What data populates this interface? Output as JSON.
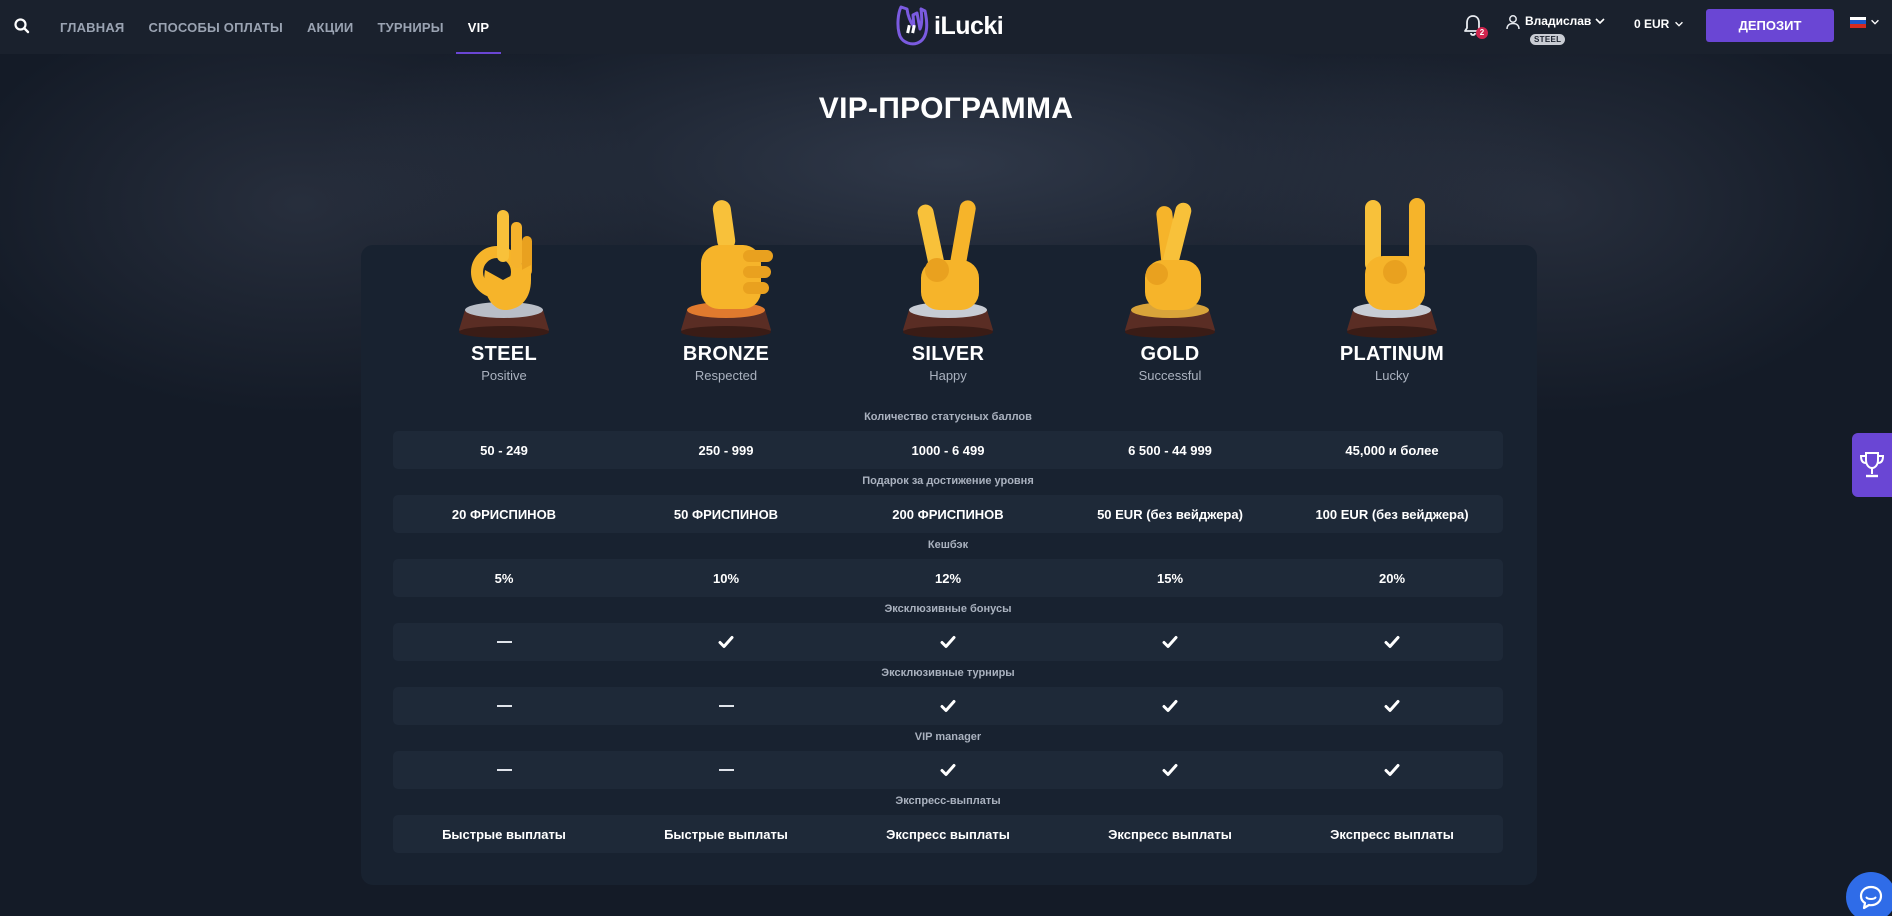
{
  "header": {
    "nav": [
      {
        "label": "ГЛАВНАЯ",
        "active": false
      },
      {
        "label": "СПОСОБЫ ОПЛАТЫ",
        "active": false
      },
      {
        "label": "АКЦИИ",
        "active": false
      },
      {
        "label": "ТУРНИРЫ",
        "active": false
      },
      {
        "label": "VIP",
        "active": true
      }
    ],
    "logo_text": "iLucki",
    "notifications_count": "2",
    "user_name": "Владислав",
    "user_level": "STEEL",
    "balance": "0 EUR",
    "deposit_label": "ДЕПОЗИТ",
    "language_flag": "russia-flag-icon"
  },
  "page": {
    "title": "VIP-ПРОГРАММА"
  },
  "tiers": [
    {
      "name": "STEEL",
      "subtitle": "Positive",
      "icon": "ok-hand-trophy-icon"
    },
    {
      "name": "BRONZE",
      "subtitle": "Respected",
      "icon": "thumbs-up-trophy-icon"
    },
    {
      "name": "SILVER",
      "subtitle": "Happy",
      "icon": "victory-hand-trophy-icon"
    },
    {
      "name": "GOLD",
      "subtitle": "Successful",
      "icon": "crossed-fingers-trophy-icon"
    },
    {
      "name": "PLATINUM",
      "subtitle": "Lucky",
      "icon": "horns-hand-trophy-icon"
    }
  ],
  "sections": [
    {
      "label": "Количество статусных баллов",
      "values": [
        "50 - 249",
        "250 - 999",
        "1000 - 6 499",
        "6 500 - 44 999",
        "45,000 и более"
      ]
    },
    {
      "label": "Подарок за достижение уровня",
      "values": [
        "20 ФРИСПИНОВ",
        "50 ФРИСПИНОВ",
        "200 ФРИСПИНОВ",
        "50 EUR (без вейджера)",
        "100 EUR (без вейджера)"
      ]
    },
    {
      "label": "Кешбэк",
      "values": [
        "5%",
        "10%",
        "12%",
        "15%",
        "20%"
      ]
    },
    {
      "label": "Эксклюзивные бонусы",
      "values": [
        false,
        true,
        true,
        true,
        true
      ]
    },
    {
      "label": "Эксклюзивные турниры",
      "values": [
        false,
        false,
        true,
        true,
        true
      ]
    },
    {
      "label": "VIP manager",
      "values": [
        false,
        false,
        true,
        true,
        true
      ]
    },
    {
      "label": "Экспресс-выплаты",
      "values": [
        "Быстрые выплаты",
        "Быстрые выплаты",
        "Экспресс выплаты",
        "Экспресс выплаты",
        "Экспресс выплаты"
      ]
    }
  ],
  "colors": {
    "accent": "#6a46d4",
    "header_bg": "#1a212d",
    "panel_bg": "#182230",
    "row_bg": "#1e2938",
    "badge": "#d0254e",
    "chat": "#2f6ce8"
  },
  "widgets": {
    "side_icon": "trophy-icon",
    "chat_icon": "chat-icon"
  }
}
